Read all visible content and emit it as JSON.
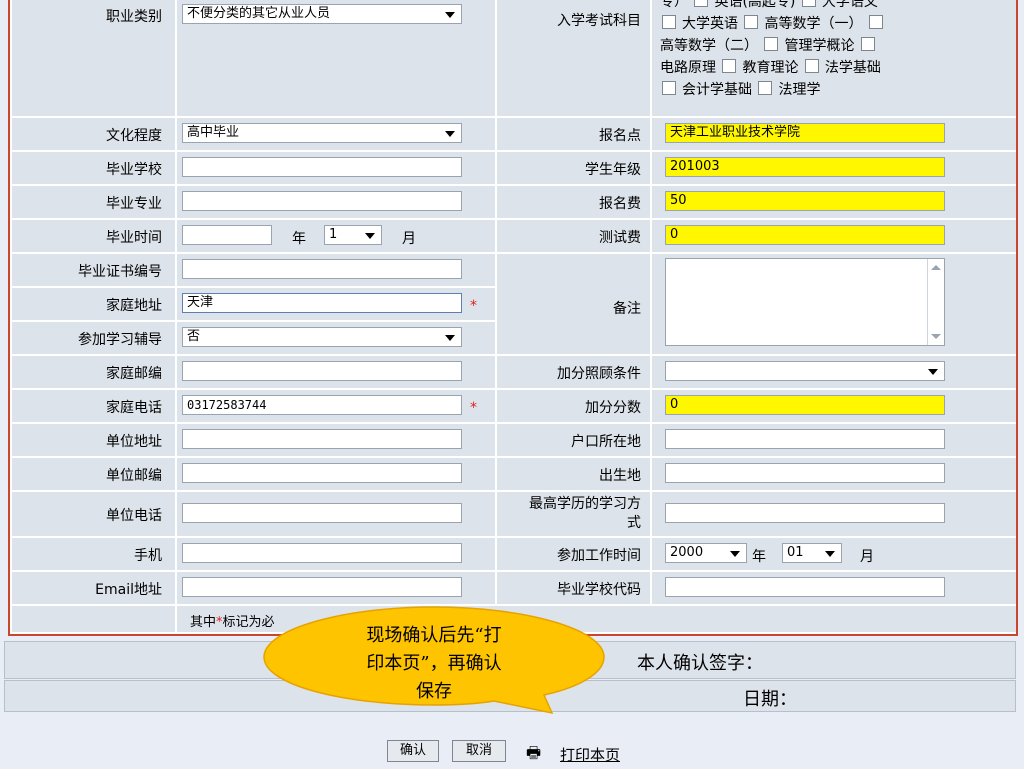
{
  "form": {
    "occupation": {
      "label": "职业类别",
      "value": "不便分类的其它从业人员"
    },
    "exam_subjects": {
      "label": "入学考试科目",
      "line1_prefix": "专）",
      "s_english_hq": "英语(高起专)",
      "s_college_chinese": "大学语文",
      "s_college_english": "大学英语",
      "s_adv_math1": "高等数学（一）",
      "s_adv_math2": "高等数学（二）",
      "s_management": "管理学概论",
      "s_circuit": "电路原理",
      "s_edu_theory": "教育理论",
      "s_law_basic": "法学基础",
      "s_accounting": "会计学基础",
      "s_jurisprudence": "法理学"
    },
    "education": {
      "label": "文化程度",
      "value": "高中毕业"
    },
    "exam_site": {
      "label": "报名点",
      "value": "天津工业职业技术学院"
    },
    "school": {
      "label": "毕业学校",
      "value": ""
    },
    "student_grade": {
      "label": "学生年级",
      "value": "201003"
    },
    "major": {
      "label": "毕业专业",
      "value": ""
    },
    "fee": {
      "label": "报名费",
      "value": "50"
    },
    "grad_time": {
      "label": "毕业时间",
      "year_value": "",
      "year_unit": "年",
      "month_value": "1",
      "month_unit": "月"
    },
    "test_fee": {
      "label": "测试费",
      "value": "0"
    },
    "cert_no": {
      "label": "毕业证书编号",
      "value": ""
    },
    "remarks": {
      "label": "备注",
      "value": ""
    },
    "home_address": {
      "label": "家庭地址",
      "value": "天津"
    },
    "tutoring": {
      "label": "参加学习辅导",
      "value": "否"
    },
    "home_zip": {
      "label": "家庭邮编",
      "value": ""
    },
    "bonus_cond": {
      "label": "加分照顾条件",
      "value": ""
    },
    "home_phone": {
      "label": "家庭电话",
      "value": "03172583744"
    },
    "bonus_score": {
      "label": "加分分数",
      "value": "0"
    },
    "work_address": {
      "label": "单位地址",
      "value": ""
    },
    "hukou": {
      "label": "户口所在地",
      "value": ""
    },
    "work_zip": {
      "label": "单位邮编",
      "value": ""
    },
    "birthplace": {
      "label": "出生地",
      "value": ""
    },
    "work_phone": {
      "label": "单位电话",
      "value": ""
    },
    "study_mode": {
      "label_line1": "最高学历的学习方",
      "label_line2": "式",
      "value": ""
    },
    "mobile": {
      "label": "手机",
      "value": ""
    },
    "work_start": {
      "label": "参加工作时间",
      "year_value": "2000",
      "year_unit": "年",
      "month_value": "01",
      "month_unit": "月"
    },
    "email": {
      "label": "Email地址",
      "value": ""
    },
    "school_code": {
      "label": "毕业学校代码",
      "value": ""
    },
    "required": {
      "star": "*",
      "note_prefix": "其中",
      "note_suffix": "标记为必"
    }
  },
  "signature": {
    "label": "本人确认签字："
  },
  "date": {
    "label": "日期："
  },
  "buttons": {
    "confirm": "确认",
    "cancel": "取消",
    "print": "打印本页"
  },
  "callout": {
    "line1": "现场确认后先“打",
    "line2": "印本页”，再确认",
    "line3": "保存"
  },
  "colors": {
    "highlight": "#fff700",
    "frame": "#c8472e",
    "callout": "#ffc400",
    "star": "#e02020"
  }
}
